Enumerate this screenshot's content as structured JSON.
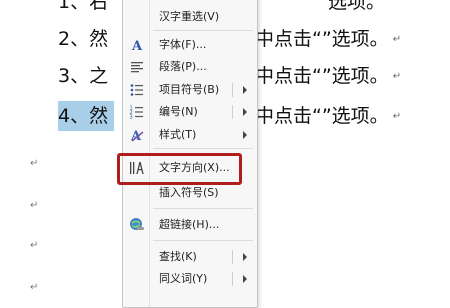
{
  "document": {
    "lines": [
      {
        "head": "1、右",
        "tail": "选项。"
      },
      {
        "head": "2、然",
        "tail": "中点击“”选项。"
      },
      {
        "head": "3、之",
        "tail": "中点击“”选项。"
      },
      {
        "head": "4、然",
        "tail": "中点击“”选项。"
      }
    ],
    "paragraph_mark": "↵"
  },
  "context_menu": {
    "items": [
      {
        "label": "汉字重选(V)",
        "icon": "",
        "submenu": false
      },
      {
        "label": "字体(F)...",
        "icon": "font-icon",
        "submenu": false
      },
      {
        "label": "段落(P)...",
        "icon": "paragraph-icon",
        "submenu": false
      },
      {
        "label": "项目符号(B)",
        "icon": "bullets-icon",
        "submenu": true
      },
      {
        "label": "编号(N)",
        "icon": "numbering-icon",
        "submenu": true
      },
      {
        "label": "样式(T)",
        "icon": "styles-icon",
        "submenu": true
      },
      {
        "label": "文字方向(X)...",
        "icon": "text-direction-icon",
        "submenu": false
      },
      {
        "label": "插入符号(S)",
        "icon": "",
        "submenu": false
      },
      {
        "label": "超链接(H)...",
        "icon": "hyperlink-icon",
        "submenu": false
      },
      {
        "label": "查找(K)",
        "icon": "",
        "submenu": true
      },
      {
        "label": "同义词(Y)",
        "icon": "",
        "submenu": true
      }
    ]
  },
  "colors": {
    "selection": "#a9cfe8",
    "highlight_box": "#b01d1d"
  }
}
